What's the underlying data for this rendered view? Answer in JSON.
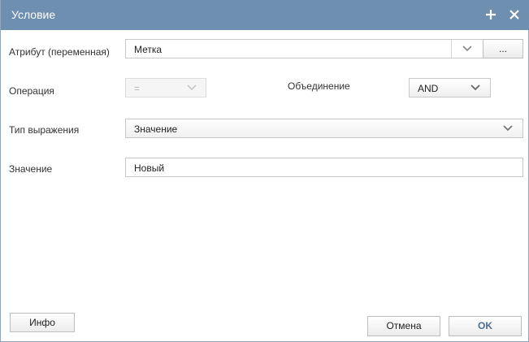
{
  "window": {
    "title": "Условие",
    "add_icon": "plus-icon",
    "close_icon": "close-icon"
  },
  "form": {
    "attribute_label": "Атрибут (переменная)",
    "attribute_value": "Метка",
    "attribute_more_label": "...",
    "operation_label": "Операция",
    "operation_value": "=",
    "union_label": "Объединение",
    "union_value": "AND",
    "expression_type_label": "Тип выражения",
    "expression_type_value": "Значение",
    "value_label": "Значение",
    "value_value": "Новый"
  },
  "footer": {
    "info_label": "Инфо",
    "cancel_label": "Отмена",
    "ok_label": "OK"
  },
  "colors": {
    "titlebar": "#6e8fb0",
    "ok_text": "#4a6d93"
  }
}
